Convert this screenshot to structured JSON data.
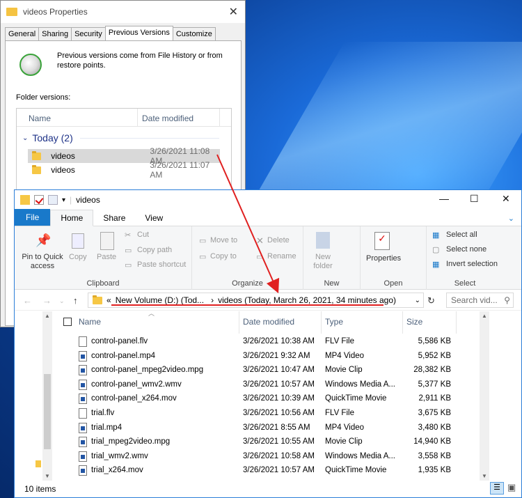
{
  "properties": {
    "title": "videos Properties",
    "close": "✕",
    "tabs": [
      "General",
      "Sharing",
      "Security",
      "Previous Versions",
      "Customize"
    ],
    "description": "Previous versions come from File History or from restore points.",
    "folder_versions_label": "Folder versions:",
    "columns": {
      "name": "Name",
      "date": "Date modified"
    },
    "group": "Today (2)",
    "versions": [
      {
        "name": "videos",
        "date": "3/26/2021 11:08 AM"
      },
      {
        "name": "videos",
        "date": "3/26/2021 11:07 AM"
      }
    ]
  },
  "explorer": {
    "title": "videos",
    "controls": {
      "minimize": "—",
      "maximize": "☐",
      "close": "✕"
    },
    "ribbon_tabs": [
      "File",
      "Home",
      "Share",
      "View"
    ],
    "clipboard": {
      "pin": "Pin to Quick access",
      "copy": "Copy",
      "paste": "Paste",
      "cut": "Cut",
      "copy_path": "Copy path",
      "paste_shortcut": "Paste shortcut",
      "label": "Clipboard"
    },
    "organize": {
      "move_to": "Move to",
      "copy_to": "Copy to",
      "delete": "Delete",
      "rename": "Rename",
      "label": "Organize"
    },
    "new": {
      "new_folder": "New folder",
      "label": "New"
    },
    "open": {
      "properties": "Properties",
      "label": "Open"
    },
    "select": {
      "select_all": "Select all",
      "select_none": "Select none",
      "invert": "Invert selection",
      "label": "Select"
    },
    "address": {
      "prefix": "«",
      "part1": "New Volume (D:) (Tod...",
      "sep": "›",
      "part2": "videos (Today, March 26, 2021, 34 minutes ago)"
    },
    "search_placeholder": "Search vid...",
    "columns": {
      "name": "Name",
      "date": "Date modified",
      "type": "Type",
      "size": "Size"
    },
    "files": [
      {
        "name": "control-panel.flv",
        "date": "3/26/2021 10:38 AM",
        "type": "FLV File",
        "size": "5,586 KB"
      },
      {
        "name": "control-panel.mp4",
        "date": "3/26/2021 9:32 AM",
        "type": "MP4 Video",
        "size": "5,952 KB"
      },
      {
        "name": "control-panel_mpeg2video.mpg",
        "date": "3/26/2021 10:47 AM",
        "type": "Movie Clip",
        "size": "28,382 KB"
      },
      {
        "name": "control-panel_wmv2.wmv",
        "date": "3/26/2021 10:57 AM",
        "type": "Windows Media A...",
        "size": "5,377 KB"
      },
      {
        "name": "control-panel_x264.mov",
        "date": "3/26/2021 10:39 AM",
        "type": "QuickTime Movie",
        "size": "2,911 KB"
      },
      {
        "name": "trial.flv",
        "date": "3/26/2021 10:56 AM",
        "type": "FLV File",
        "size": "3,675 KB"
      },
      {
        "name": "trial.mp4",
        "date": "3/26/2021 8:55 AM",
        "type": "MP4 Video",
        "size": "3,480 KB"
      },
      {
        "name": "trial_mpeg2video.mpg",
        "date": "3/26/2021 10:55 AM",
        "type": "Movie Clip",
        "size": "14,940 KB"
      },
      {
        "name": "trial_wmv2.wmv",
        "date": "3/26/2021 10:58 AM",
        "type": "Windows Media A...",
        "size": "3,558 KB"
      },
      {
        "name": "trial_x264.mov",
        "date": "3/26/2021 10:57 AM",
        "type": "QuickTime Movie",
        "size": "1,935 KB"
      }
    ],
    "status": "10 items"
  }
}
